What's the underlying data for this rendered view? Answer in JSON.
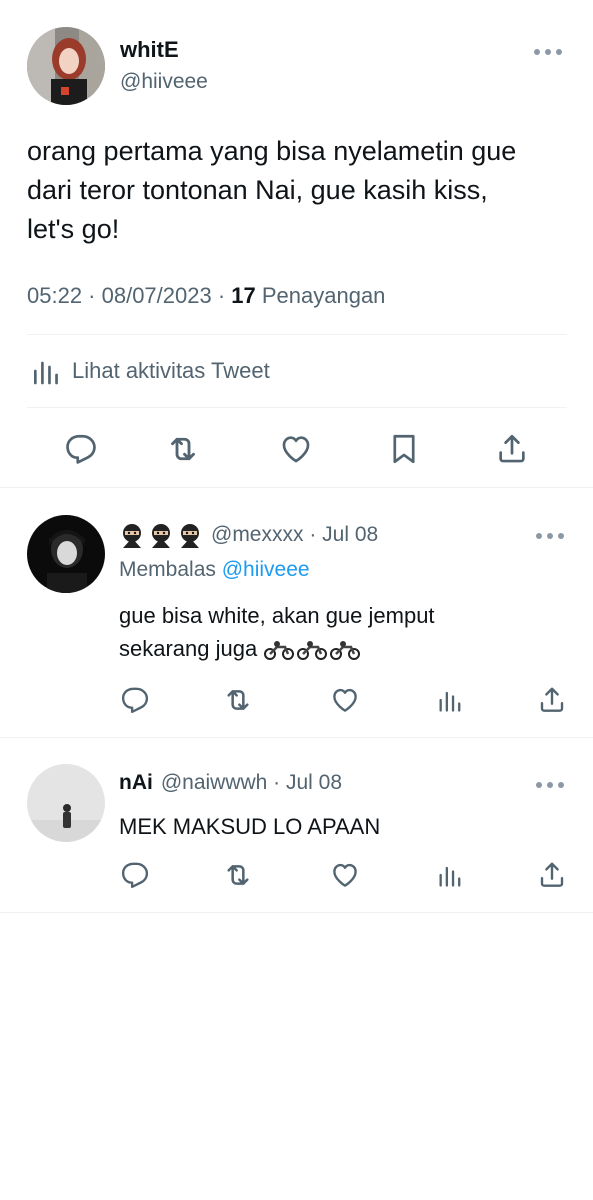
{
  "main_tweet": {
    "name": "whitE",
    "handle": "@hiiveee",
    "text": "orang pertama yang bisa nyelametin gue\ndari teror tontonan Nai, gue kasih kiss,\nlet's go!",
    "time": "05:22 · 08/07/2023 · ",
    "views_count": "17",
    "views_label": " Penayangan",
    "activity_label": "Lihat aktivitas Tweet"
  },
  "replies": [
    {
      "name": "",
      "handle": "@mexxxx · Jul 08",
      "replying_prefix": "Membalas ",
      "replying_to": "@hiiveee",
      "text": "gue bisa white, akan gue jemput\nsekarang juga"
    },
    {
      "name": "nAi",
      "handle": "@naiwwwh · Jul 08",
      "text": "MEK MAKSUD LO APAAN"
    }
  ],
  "icons": [
    "reply-icon",
    "retweet-icon",
    "like-icon",
    "bookmark-icon",
    "share-icon",
    "views-icon",
    "more-icon",
    "ninja-emoji",
    "motorcycle-emoji"
  ],
  "colors": {
    "text": "#0f1419",
    "muted": "#536471",
    "link": "#1d9bf0",
    "divider": "#eff3f4"
  }
}
